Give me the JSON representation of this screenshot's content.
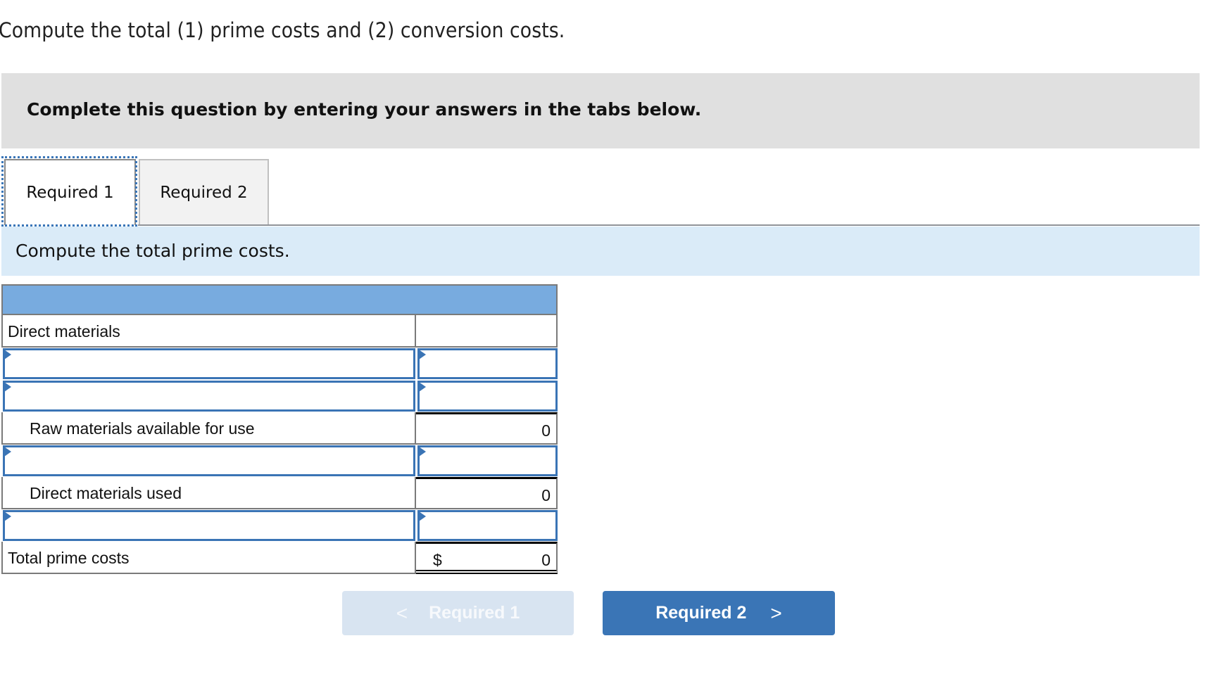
{
  "question": "Compute the total (1) prime costs and (2) conversion costs.",
  "banner": "Complete this question by entering your answers in the tabs below.",
  "tabs": [
    {
      "label": "Required 1",
      "active": true
    },
    {
      "label": "Required 2",
      "active": false
    }
  ],
  "instruction": "Compute the total prime costs.",
  "table": {
    "header": "",
    "rows": [
      {
        "type": "label",
        "label": "Direct materials",
        "value": ""
      },
      {
        "type": "input",
        "label": "",
        "value": ""
      },
      {
        "type": "input",
        "label": "",
        "value": ""
      },
      {
        "type": "computed",
        "label": "Raw materials available for use",
        "value": "0"
      },
      {
        "type": "input",
        "label": "",
        "value": ""
      },
      {
        "type": "computed",
        "label": "Direct materials used",
        "value": "0"
      },
      {
        "type": "input",
        "label": "",
        "value": ""
      },
      {
        "type": "total",
        "label": "Total prime costs",
        "currency": "$",
        "value": "0"
      }
    ]
  },
  "nav": {
    "prev_label": "Required 1",
    "prev_icon": "chevron-left-icon",
    "prev_glyph": "<",
    "next_label": "Required 2",
    "next_icon": "chevron-right-icon",
    "next_glyph": ">"
  },
  "colors": {
    "accent": "#3a75b6",
    "header_blue": "#78abdf",
    "instruction_bg": "#daebf8",
    "banner_bg": "#e0e0e0",
    "disabled_button": "#d8e4f1"
  }
}
